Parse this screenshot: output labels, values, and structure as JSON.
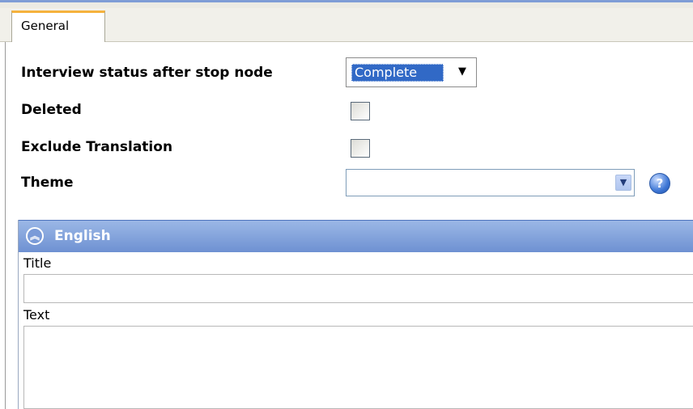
{
  "tabs": [
    {
      "label": "General",
      "active": true
    }
  ],
  "form": {
    "interview_status_label": "Interview status after stop node",
    "interview_status_value": "Complete",
    "deleted_label": "Deleted",
    "deleted_checked": false,
    "exclude_translation_label": "Exclude Translation",
    "exclude_translation_checked": false,
    "theme_label": "Theme",
    "theme_value": ""
  },
  "language_panel": {
    "title": "English",
    "title_field_label": "Title",
    "title_value": "",
    "text_field_label": "Text",
    "text_value": ""
  },
  "icons": {
    "combo_arrow": "triangle-down-icon",
    "theme_dropdown": "chevron-down-icon",
    "help": "question-mark-icon",
    "collapse": "double-chevron-up-icon"
  },
  "colors": {
    "selection": "#3169c6",
    "panel_header": "#7b9dd8",
    "tab_accent": "#f5b23d"
  }
}
